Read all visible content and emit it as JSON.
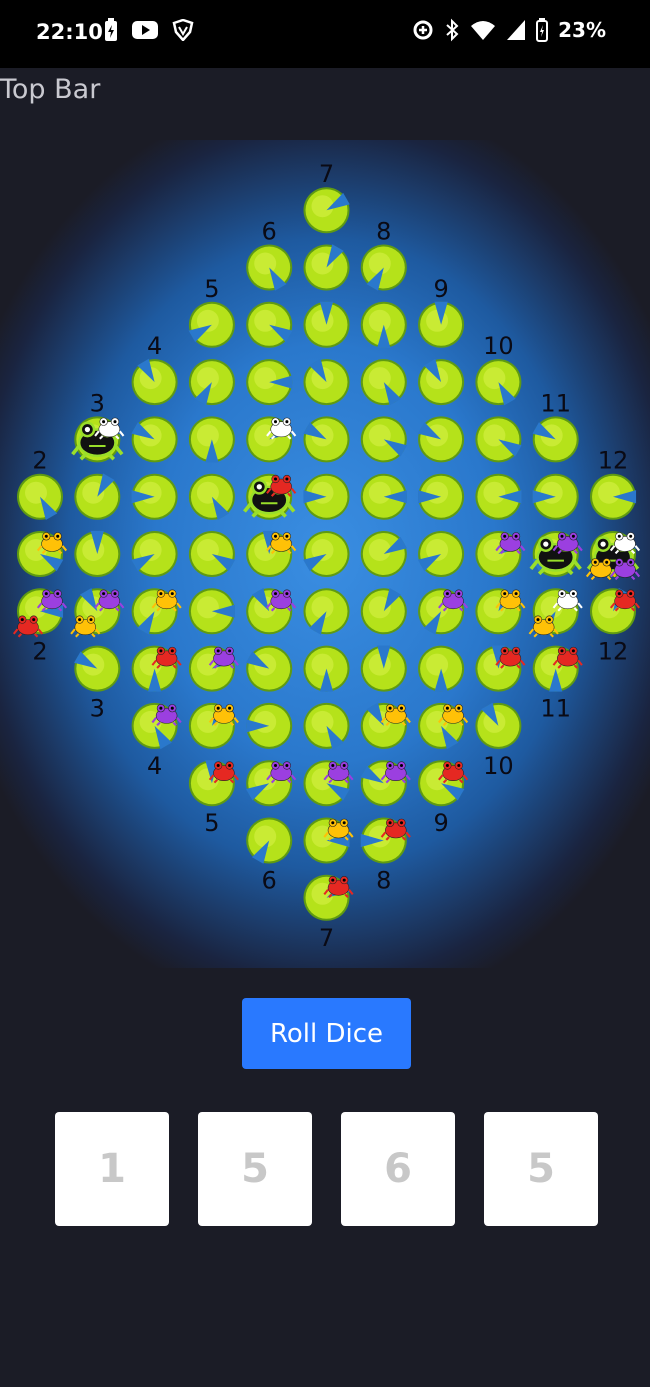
{
  "status_bar": {
    "time": "22:10",
    "battery": "23%",
    "left_icons": [
      "battery-saver-icon",
      "youtube-icon",
      "shield-vpn-icon"
    ],
    "right_icons": [
      "data-saver-icon",
      "bluetooth-icon",
      "wifi-icon",
      "signal-icon",
      "battery-icon"
    ]
  },
  "top_bar": {
    "title": "Top Bar"
  },
  "board": {
    "column_labels": [
      "2",
      "3",
      "4",
      "5",
      "6",
      "7",
      "8",
      "9",
      "10",
      "11",
      "12"
    ],
    "column_heights": [
      3,
      5,
      7,
      9,
      11,
      13,
      11,
      9,
      7,
      5,
      3
    ],
    "colors": {
      "pad": "#b5e21a",
      "pad_dark": "#5f9a12",
      "water": "#2a78cc",
      "yellow_frog": "#ffc107",
      "purple_frog": "#9b3fe0",
      "red_frog": "#e52822",
      "white_frog": "#ffffff",
      "black_frog": "#111111"
    },
    "big_frogs": [
      {
        "color": "black",
        "column": "3",
        "row": 4
      },
      {
        "color": "black",
        "column": "6",
        "row": 6
      },
      {
        "color": "black",
        "column": "11",
        "row": 2
      },
      {
        "color": "black",
        "column": "12",
        "row": 1
      }
    ],
    "small_frogs": [
      {
        "color": "white",
        "column": "3",
        "row": 4
      },
      {
        "color": "purple",
        "column": "6",
        "row": 4
      },
      {
        "color": "yellow",
        "column": "6",
        "row": 5
      },
      {
        "color": "red",
        "column": "6",
        "row": 6
      },
      {
        "color": "white",
        "column": "6",
        "row": 7
      },
      {
        "color": "white",
        "column": "12",
        "row": 1
      },
      {
        "color": "yellow",
        "column": "12",
        "row": 1
      },
      {
        "color": "purple",
        "column": "12",
        "row": 1
      },
      {
        "color": "purple",
        "column": "11",
        "row": 2
      },
      {
        "color": "yellow",
        "column": "2",
        "row": 1
      },
      {
        "color": "purple",
        "column": "2",
        "row": 0
      },
      {
        "color": "red",
        "column": "2",
        "row": 0
      },
      {
        "color": "purple",
        "column": "3",
        "row": 1
      },
      {
        "color": "yellow",
        "column": "3",
        "row": 1
      },
      {
        "color": "yellow",
        "column": "4",
        "row": 2
      },
      {
        "color": "red",
        "column": "4",
        "row": 1
      },
      {
        "color": "purple",
        "column": "5",
        "row": 2
      },
      {
        "color": "yellow",
        "column": "5",
        "row": 1
      },
      {
        "color": "purple",
        "column": "4",
        "row": 0
      },
      {
        "color": "red",
        "column": "5",
        "row": 0
      },
      {
        "color": "yellow",
        "column": "7",
        "row": 1
      },
      {
        "color": "red",
        "column": "7",
        "row": 0
      },
      {
        "color": "red",
        "column": "8",
        "row": 0
      },
      {
        "color": "purple",
        "column": "8",
        "row": 1
      },
      {
        "color": "yellow",
        "column": "8",
        "row": 2
      },
      {
        "color": "purple",
        "column": "6",
        "row": 1
      },
      {
        "color": "purple",
        "column": "7",
        "row": 2
      },
      {
        "color": "yellow",
        "column": "9",
        "row": 1
      },
      {
        "color": "red",
        "column": "9",
        "row": 0
      },
      {
        "color": "purple",
        "column": "9",
        "row": 3
      },
      {
        "color": "red",
        "column": "10",
        "row": 1
      },
      {
        "color": "yellow",
        "column": "10",
        "row": 2
      },
      {
        "color": "purple",
        "column": "10",
        "row": 3
      },
      {
        "color": "white",
        "column": "11",
        "row": 1
      },
      {
        "color": "yellow",
        "column": "11",
        "row": 1
      },
      {
        "color": "red",
        "column": "11",
        "row": 0
      },
      {
        "color": "red",
        "column": "12",
        "row": 0
      }
    ]
  },
  "roll_button": {
    "label": "Roll Dice"
  },
  "dice": [
    "1",
    "5",
    "6",
    "5"
  ]
}
